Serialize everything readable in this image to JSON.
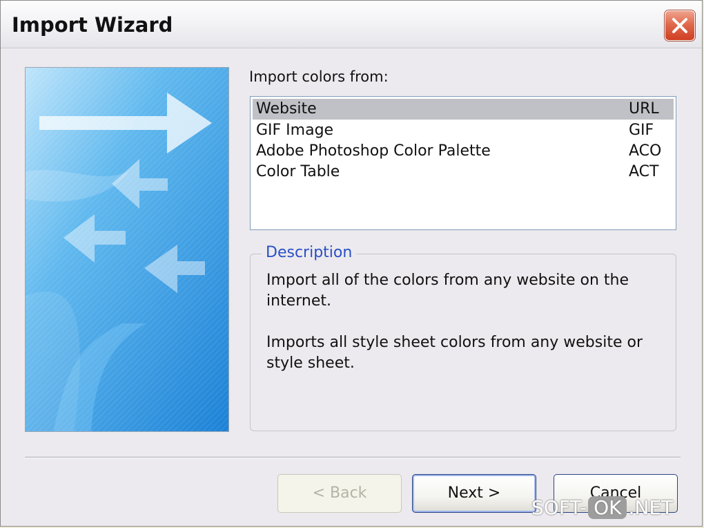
{
  "window": {
    "title": "Import Wizard"
  },
  "import_list": {
    "label": "Import colors from:",
    "items": [
      {
        "name": "Website",
        "ext": "URL",
        "selected": true
      },
      {
        "name": "GIF Image",
        "ext": "GIF",
        "selected": false
      },
      {
        "name": "Adobe Photoshop Color Palette",
        "ext": "ACO",
        "selected": false
      },
      {
        "name": "Color Table",
        "ext": "ACT",
        "selected": false
      }
    ]
  },
  "description": {
    "legend": "Description",
    "paragraph1_line1": "Import all of the colors from any website on the",
    "paragraph1_line2": "internet.",
    "paragraph2_line1": "Imports all style sheet colors from any website or",
    "paragraph2_line2": "style sheet."
  },
  "buttons": {
    "back": "< Back",
    "next": "Next >",
    "cancel": "Cancel"
  },
  "watermark": {
    "part1": "SOFT-",
    "part2": "OK",
    "part3": ".NET"
  }
}
